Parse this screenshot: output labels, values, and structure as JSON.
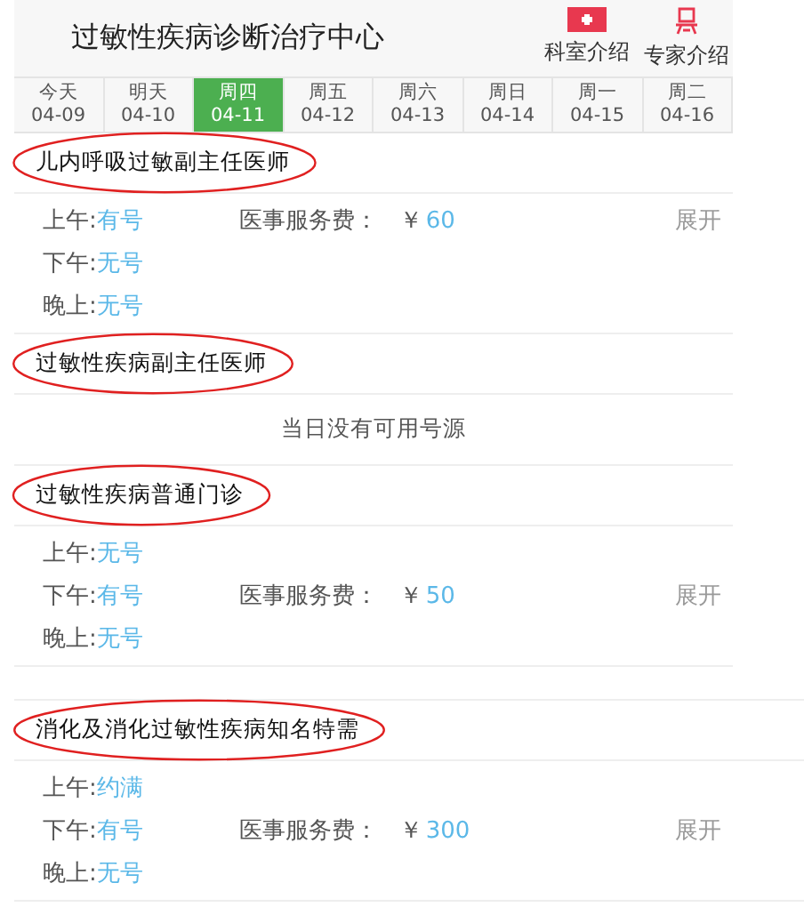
{
  "header": {
    "title": "过敏性疾病诊断治疗中心",
    "links": [
      {
        "label": "科室介绍",
        "kind": "kit"
      },
      {
        "label": "专家介绍",
        "kind": "person"
      }
    ]
  },
  "date_tabs": [
    {
      "weekday": "今天",
      "date": "04-09",
      "selected": false
    },
    {
      "weekday": "明天",
      "date": "04-10",
      "selected": false
    },
    {
      "weekday": "周四",
      "date": "04-11",
      "selected": true
    },
    {
      "weekday": "周五",
      "date": "04-12",
      "selected": false
    },
    {
      "weekday": "周六",
      "date": "04-13",
      "selected": false
    },
    {
      "weekday": "周日",
      "date": "04-14",
      "selected": false
    },
    {
      "weekday": "周一",
      "date": "04-15",
      "selected": false
    },
    {
      "weekday": "周二",
      "date": "04-16",
      "selected": false
    }
  ],
  "sections": [
    {
      "title": "儿内呼吸过敏副主任医师",
      "kind": "sessions",
      "sessions": [
        {
          "label": "上午:",
          "status": "有号",
          "fee_label": "医事服务费：",
          "currency": "￥",
          "fee": "60",
          "expand": "展开"
        },
        {
          "label": "下午:",
          "status": "无号"
        },
        {
          "label": "晚上:",
          "status": "无号"
        }
      ]
    },
    {
      "title": "过敏性疾病副主任医师",
      "kind": "notice",
      "notice": "当日没有可用号源"
    },
    {
      "title": "过敏性疾病普通门诊",
      "kind": "sessions",
      "sessions": [
        {
          "label": "上午:",
          "status": "无号"
        },
        {
          "label": "下午:",
          "status": "有号",
          "fee_label": "医事服务费：",
          "currency": "￥",
          "fee": "50",
          "expand": "展开"
        },
        {
          "label": "晚上:",
          "status": "无号"
        }
      ]
    },
    {
      "title": "消化及消化过敏性疾病知名特需",
      "kind": "sessions",
      "sessions": [
        {
          "label": "上午:",
          "status": "约满"
        },
        {
          "label": "下午:",
          "status": "有号",
          "fee_label": "医事服务费：",
          "currency": "￥",
          "fee": "300",
          "expand": "展开"
        },
        {
          "label": "晚上:",
          "status": "无号"
        }
      ]
    }
  ]
}
